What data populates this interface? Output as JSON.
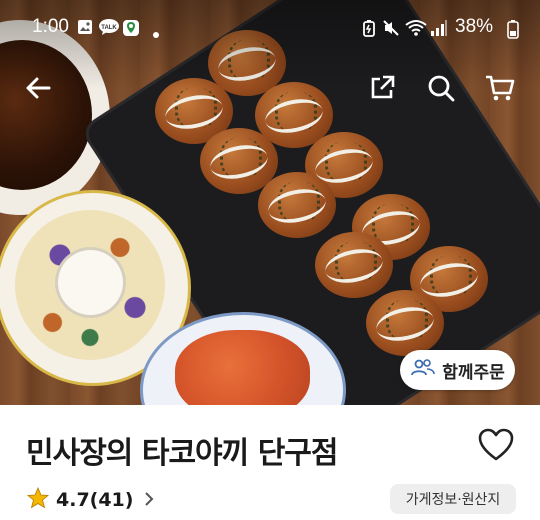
{
  "status_bar": {
    "time": "1:00",
    "battery": "38%",
    "notification_icons": [
      "gallery-icon",
      "talk-icon",
      "maps-icon",
      "dot-icon"
    ],
    "system_icons": [
      "battery-saver-icon",
      "mute-icon",
      "wifi-icon",
      "signal-icon",
      "battery-icon"
    ]
  },
  "top_bar": {
    "icons": [
      "back-arrow-icon",
      "share-icon",
      "search-icon",
      "cart-icon"
    ]
  },
  "hero": {
    "together_order_label": "함께주문"
  },
  "store": {
    "name": "민사장의 타코야끼 단구점",
    "rating": "4.7(41)",
    "info_button_label": "가게정보·원산지"
  },
  "colors": {
    "accent_star": "#F5B600",
    "text_primary": "#1A1A1A",
    "info_button_bg": "#EEEEEE"
  }
}
